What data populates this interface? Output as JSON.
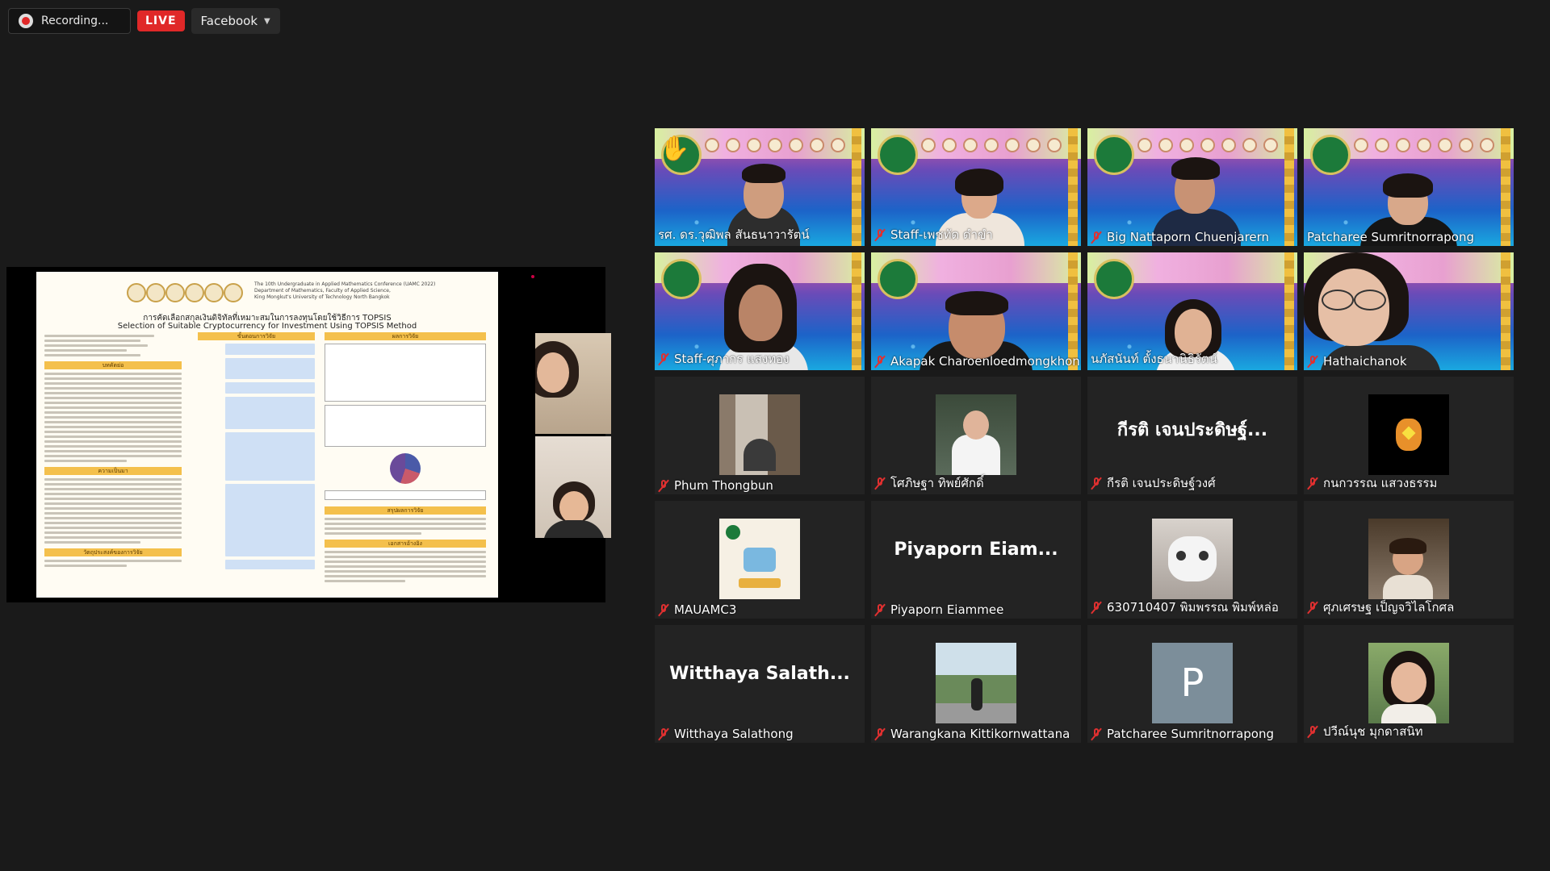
{
  "topbar": {
    "recording_label": "Recording...",
    "live_label": "LIVE",
    "platform_label": "Facebook"
  },
  "poster": {
    "conference_line1": "The 10th Undergraduate in Applied Mathematics Conference (UAMC 2022)",
    "conference_line2": "Department of Mathematics, Faculty of Applied Science,",
    "conference_line3": "King Mongkut's University of Technology North Bangkok",
    "title_th": "การคัดเลือกสกุลเงินดิจิทัลที่เหมาะสมในการลงทุนโดยใช้วิธีการ TOPSIS",
    "title_en": "Selection of Suitable Cryptocurrency for Investment Using TOPSIS Method",
    "sec_intro": "บทคัดย่อ",
    "sec_steps": "ขั้นตอนการวิจัย",
    "sec_results": "ผลการวิจัย",
    "sec_background": "ความเป็นมา",
    "sec_objective": "วัตถุประสงค์ของการวิจัย",
    "sec_summary": "สรุปผลการวิจัย",
    "sec_references": "เอกสารอ้างอิง"
  },
  "participants": [
    {
      "name": "รศ. ดร.วุฒิพล สันธนาวารัตน์",
      "type": "video",
      "muted": false,
      "hand": true
    },
    {
      "name": "Staff-เพชทัด ดำขำ",
      "type": "video",
      "muted": true
    },
    {
      "name": "Big Nattaporn Chuenjarern",
      "type": "video",
      "muted": true
    },
    {
      "name": "Patcharee Sumritnorrapong",
      "type": "video",
      "muted": false
    },
    {
      "name": "Staff-ศุภากร แสงทอง",
      "type": "video",
      "muted": true
    },
    {
      "name": "Akapak Charoenloedmongkhon",
      "type": "video",
      "muted": true
    },
    {
      "name": "นภัสนันท์ ตั้งธนานิธิรัตน์",
      "type": "video",
      "muted": false,
      "speaking": true
    },
    {
      "name": "Hathaichanok",
      "type": "video",
      "muted": true
    },
    {
      "name": "Phum Thongbun",
      "type": "avatar",
      "muted": true
    },
    {
      "name": "โศภิษฐา ทิพย์ศักดิ์",
      "type": "avatar",
      "muted": true
    },
    {
      "name": "กีรติ เจนประดิษฐ์วงศ์",
      "type": "text",
      "muted": true,
      "big_text": "กีรติ เจนประดิษฐ์..."
    },
    {
      "name": "กนกวรรณ แสวงธรรม",
      "type": "avatar",
      "muted": true
    },
    {
      "name": "MAUAMC3",
      "type": "avatar",
      "muted": true
    },
    {
      "name": "Piyaporn Eiammee",
      "type": "text",
      "muted": true,
      "big_text": "Piyaporn  Eiam..."
    },
    {
      "name": "630710407 พิมพรรณ พิมพ์หล่อ",
      "type": "avatar",
      "muted": true
    },
    {
      "name": "ศุภเศรษฐ เป็ญจวิไลโกศล",
      "type": "avatar",
      "muted": true
    },
    {
      "name": "Witthaya Salathong",
      "type": "text",
      "muted": true,
      "big_text": "Witthaya  Salath..."
    },
    {
      "name": "Warangkana Kittikornwattana",
      "type": "avatar",
      "muted": true
    },
    {
      "name": "Patcharee Sumritnorrapong",
      "type": "letter",
      "muted": true,
      "letter": "P"
    },
    {
      "name": "ปวีณ์นุช มุกดาสนิท",
      "type": "avatar",
      "muted": true
    }
  ],
  "colors": {
    "background": "#1a1a1a",
    "tile": "#232323",
    "live": "#e02828",
    "mute": "#e03030",
    "speaker_outline": "#d6e060"
  },
  "icons": [
    "recording-icon",
    "chevron-down-icon",
    "mic-muted-icon",
    "raised-hand-icon"
  ]
}
